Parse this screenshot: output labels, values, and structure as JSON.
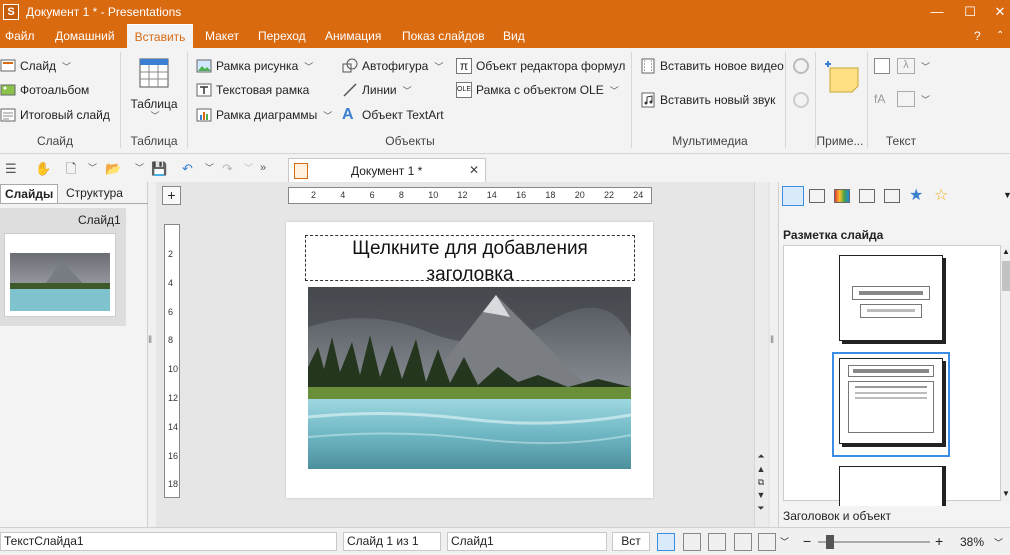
{
  "window": {
    "title": "Документ 1 * - Presentations",
    "app_icon_letter": "S"
  },
  "menu": {
    "items": [
      "Файл",
      "Домашний",
      "Вставить",
      "Макет",
      "Переход",
      "Анимация",
      "Показ слайдов",
      "Вид"
    ],
    "help": "?"
  },
  "ribbon": {
    "slide_group": {
      "items": [
        "Слайд",
        "Фотоальбом",
        "Итоговый слайд"
      ],
      "label": "Слайд"
    },
    "table_group": {
      "button": "Таблица",
      "label": "Таблица"
    },
    "objects_group": {
      "col1": [
        "Рамка рисунка",
        "Текстовая рамка",
        "Рамка диаграммы"
      ],
      "col2": [
        "Автофигура",
        "Линии",
        "Объект TextArt"
      ],
      "col3": [
        "Объект редактора формул",
        "Рамка с объектом OLE"
      ],
      "label": "Объекты"
    },
    "multimedia_group": {
      "items": [
        "Вставить новое видео",
        "Вставить новый звук"
      ],
      "label": "Мультимедиа"
    },
    "notes_group": {
      "label": "Приме..."
    },
    "text_group": {
      "label": "Текст"
    }
  },
  "document_tab": {
    "title": "Документ 1 *"
  },
  "left_pane": {
    "tabs": [
      "Слайды",
      "Структура"
    ],
    "slide_label": "Слайд1"
  },
  "ruler": {
    "h_ticks": [
      "2",
      "4",
      "6",
      "8",
      "10",
      "12",
      "14",
      "16",
      "18",
      "20",
      "22",
      "24"
    ],
    "v_ticks": [
      "2",
      "4",
      "6",
      "8",
      "10",
      "12",
      "14",
      "16",
      "18"
    ]
  },
  "slide": {
    "title_placeholder": "Щелкните для добавления заголовка"
  },
  "right_pane": {
    "heading": "Разметка слайда",
    "layout_caption": "Заголовок и объект"
  },
  "status": {
    "field1": "ТекстСлайда1",
    "field2": "Слайд 1 из 1",
    "field3": "Слайд1",
    "mode": "Вст",
    "zoom": "38%"
  },
  "colors": {
    "accent": "#d96a10",
    "selection": "#3a8ee6"
  }
}
